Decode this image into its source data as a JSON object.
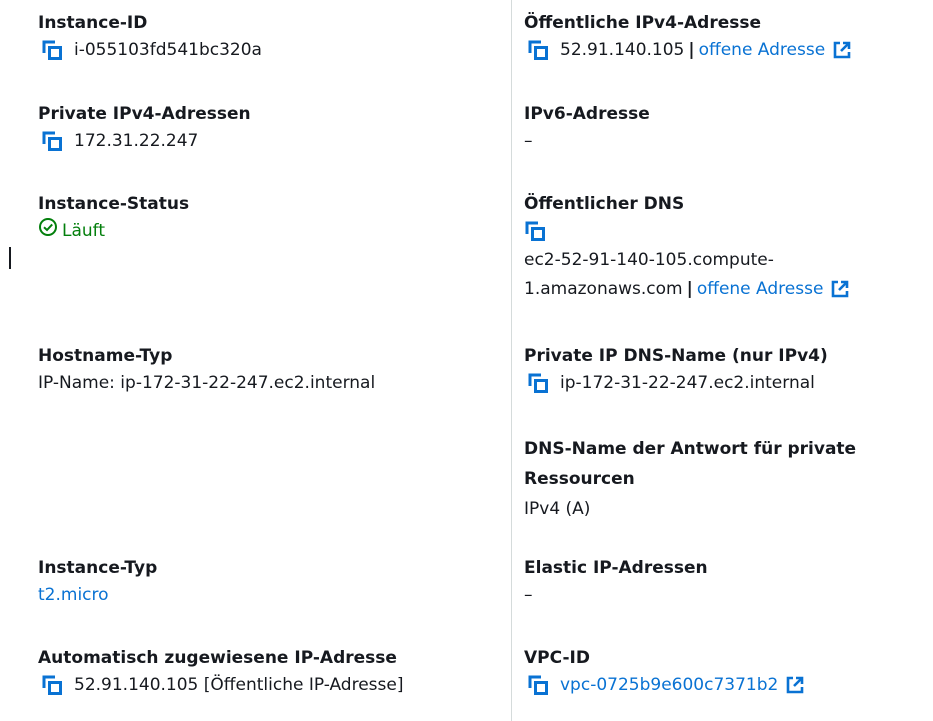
{
  "colors": {
    "link": "#0972d3",
    "success": "#037f0c",
    "text": "#16191f",
    "divider": "#d5dbdb"
  },
  "icons": {
    "copy": "copy-icon",
    "external": "external-link-icon",
    "status": "status-check-icon"
  },
  "left": {
    "instance_id": {
      "label": "Instance-ID",
      "value": "i-055103fd541bc320a"
    },
    "private_ipv4": {
      "label": "Private IPv4-Adressen",
      "value": "172.31.22.247"
    },
    "instance_status": {
      "label": "Instance-Status",
      "value": "Läuft"
    },
    "hostname_type": {
      "label": "Hostname-Typ",
      "value": "IP-Name: ip-172-31-22-247.ec2.internal"
    },
    "instance_type": {
      "label": "Instance-Typ",
      "value": "t2.micro"
    },
    "auto_ip": {
      "label": "Automatisch zugewiesene IP-Adresse",
      "value": "52.91.140.105 [Öffentliche IP-Adresse]"
    }
  },
  "right": {
    "public_ipv4": {
      "label": "Öffentliche IPv4-Adresse",
      "value": "52.91.140.105",
      "separator": "|",
      "link": "offene Adresse"
    },
    "ipv6": {
      "label": "IPv6-Adresse",
      "value": "–"
    },
    "public_dns": {
      "label": "Öffentlicher DNS",
      "value_line1": "ec2-52-91-140-105.compute-",
      "value_line2": "1.amazonaws.com",
      "separator": "|",
      "link": "offene Adresse"
    },
    "private_dns": {
      "label": "Private IP DNS-Name (nur IPv4)",
      "value": "ip-172-31-22-247.ec2.internal"
    },
    "dns_answer": {
      "label_line1": "DNS-Name der Antwort für private",
      "label_line2": "Ressourcen",
      "value": "IPv4 (A)"
    },
    "elastic_ip": {
      "label": "Elastic IP-Adressen",
      "value": "–"
    },
    "vpc": {
      "label": "VPC-ID",
      "link": "vpc-0725b9e600c7371b2"
    }
  }
}
